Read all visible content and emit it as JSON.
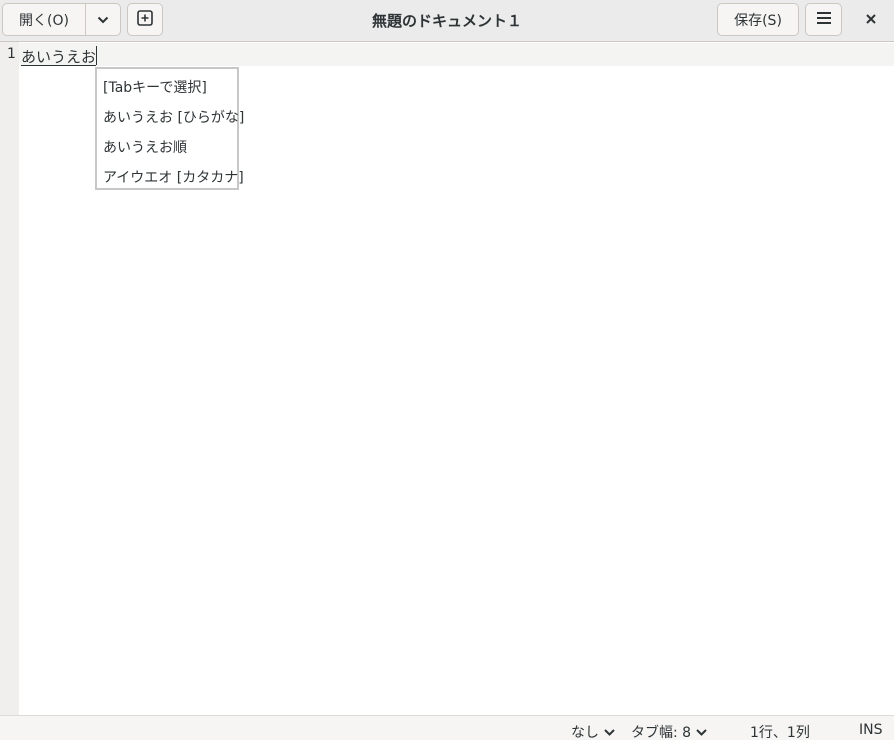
{
  "header": {
    "open_label": "開く(O)",
    "title": "無題のドキュメント１",
    "save_label": "保存(S)"
  },
  "icons": {
    "open_menu": "chevron-down-icon",
    "new_tab": "new-tab-icon",
    "menu": "hamburger-menu-icon",
    "close": "close-icon"
  },
  "editor": {
    "line_number": "1",
    "line_text": "あいうえお"
  },
  "completion": {
    "items": [
      "[Tabキーで選択]",
      "あいうえお [ひらがな]",
      "あいうえお順",
      "アイウエオ [カタカナ]"
    ]
  },
  "statusbar": {
    "language": "なし",
    "tab_width": "タブ幅: 8",
    "position": "1行、1列",
    "mode": "INS"
  }
}
